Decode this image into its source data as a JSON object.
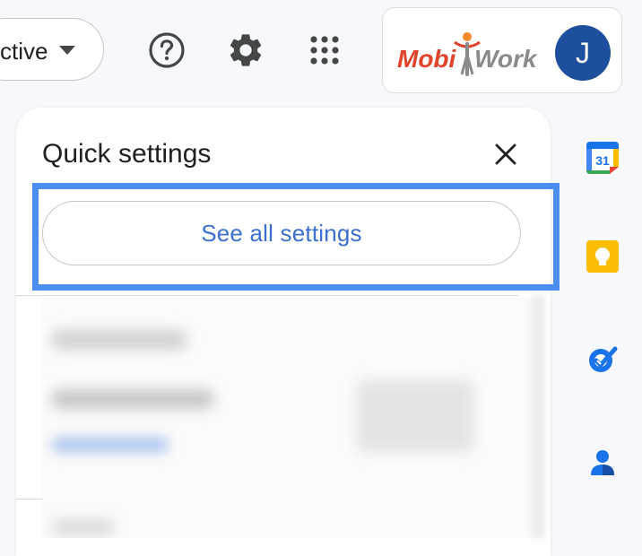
{
  "topbar": {
    "status_text": "ctive",
    "help_icon": "help-circle-icon",
    "settings_icon": "gear-icon",
    "apps_icon": "apps-grid-icon"
  },
  "account": {
    "logo_text_left": "Mobi",
    "logo_text_right": "Work",
    "avatar_initial": "J",
    "avatar_color": "#1d4f9c"
  },
  "quick_settings": {
    "title": "Quick settings",
    "close_icon": "close-icon",
    "see_all_label": "See all settings",
    "highlight_color": "#4a8ff0"
  },
  "right_rail": {
    "calendar_icon": "calendar-icon",
    "calendar_date": "31",
    "keep_icon": "keep-icon",
    "tasks_icon": "tasks-icon",
    "contacts_icon": "contacts-icon"
  },
  "colors": {
    "accent_blue": "#3b6fd1",
    "background": "#f6f8fc"
  }
}
